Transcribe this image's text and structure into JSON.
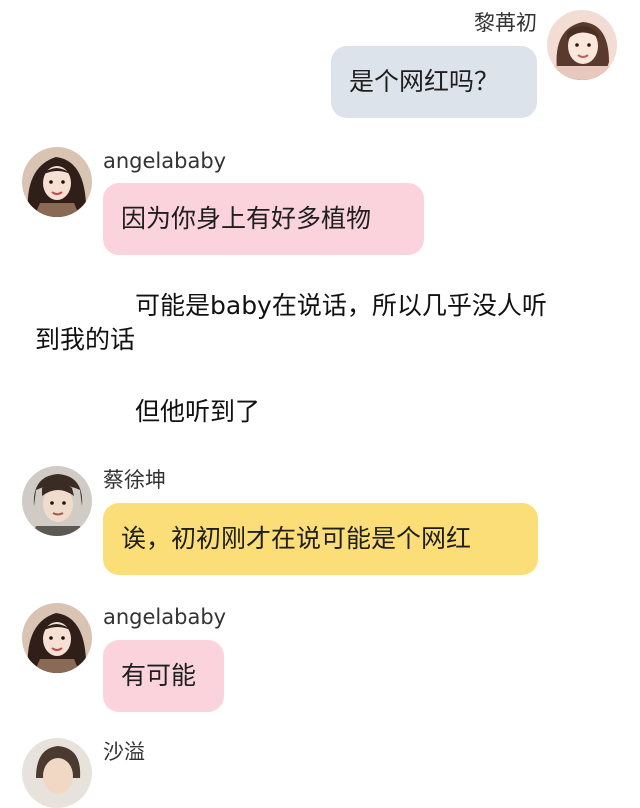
{
  "messages": [
    {
      "sender": "黎苒初",
      "text": "是个网红吗？",
      "side": "right",
      "bubble_color": "#dde3ea"
    },
    {
      "sender": "angelababy",
      "text": "因为你身上有好多植物",
      "side": "left",
      "bubble_color": "#fbd3dc"
    },
    {
      "sender": "蔡徐坤",
      "text": "诶，初初刚才在说可能是个网红",
      "side": "left",
      "bubble_color": "#fcde78"
    },
    {
      "sender": "angelababy",
      "text": "有可能",
      "side": "left",
      "bubble_color": "#fbd3dc"
    },
    {
      "sender": "沙溢",
      "text": "",
      "side": "left"
    }
  ],
  "narration": {
    "line1": "可能是baby在说话，所以几乎没人听",
    "line2": "到我的话",
    "line3": "但他听到了"
  }
}
